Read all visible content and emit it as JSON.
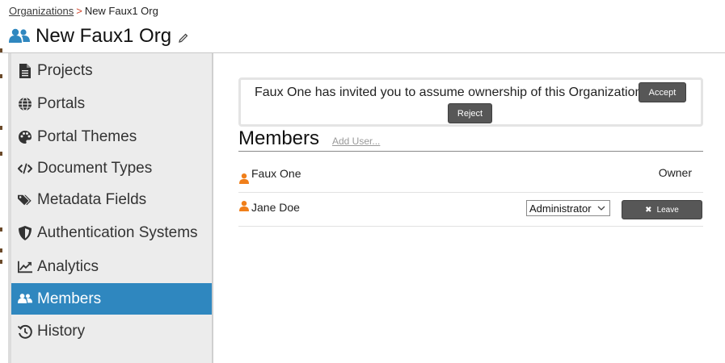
{
  "breadcrumb": {
    "link": "Organizations",
    "separator": ">",
    "current": "New Faux1 Org"
  },
  "header": {
    "title": "New Faux1 Org"
  },
  "sidebar": {
    "items": [
      {
        "label": "Projects",
        "icon": "file-icon"
      },
      {
        "label": "Portals",
        "icon": "globe-icon"
      },
      {
        "label": "Portal Themes",
        "icon": "palette-icon"
      },
      {
        "label": "Document Types",
        "icon": "code-icon"
      },
      {
        "label": "Metadata Fields",
        "icon": "tags-icon"
      },
      {
        "label": "Authentication Systems",
        "icon": "shield-icon"
      },
      {
        "label": "Analytics",
        "icon": "chart-line-icon"
      },
      {
        "label": "Members",
        "icon": "users-icon",
        "active": true
      },
      {
        "label": "History",
        "icon": "history-icon"
      }
    ]
  },
  "invite": {
    "message": "Faux One has invited you to assume ownership of this Organization",
    "accept_label": "Accept",
    "reject_label": "Reject"
  },
  "members": {
    "heading": "Members",
    "add_user_label": "Add User...",
    "rows": [
      {
        "name": "Faux One",
        "role": "Owner"
      },
      {
        "name": "Jane Doe",
        "role_select_value": "Administrator",
        "leave_label": "Leave"
      }
    ]
  },
  "colors": {
    "accent": "#2f87bf",
    "person_icon": "#f07f1a",
    "button_dark": "#575757"
  }
}
